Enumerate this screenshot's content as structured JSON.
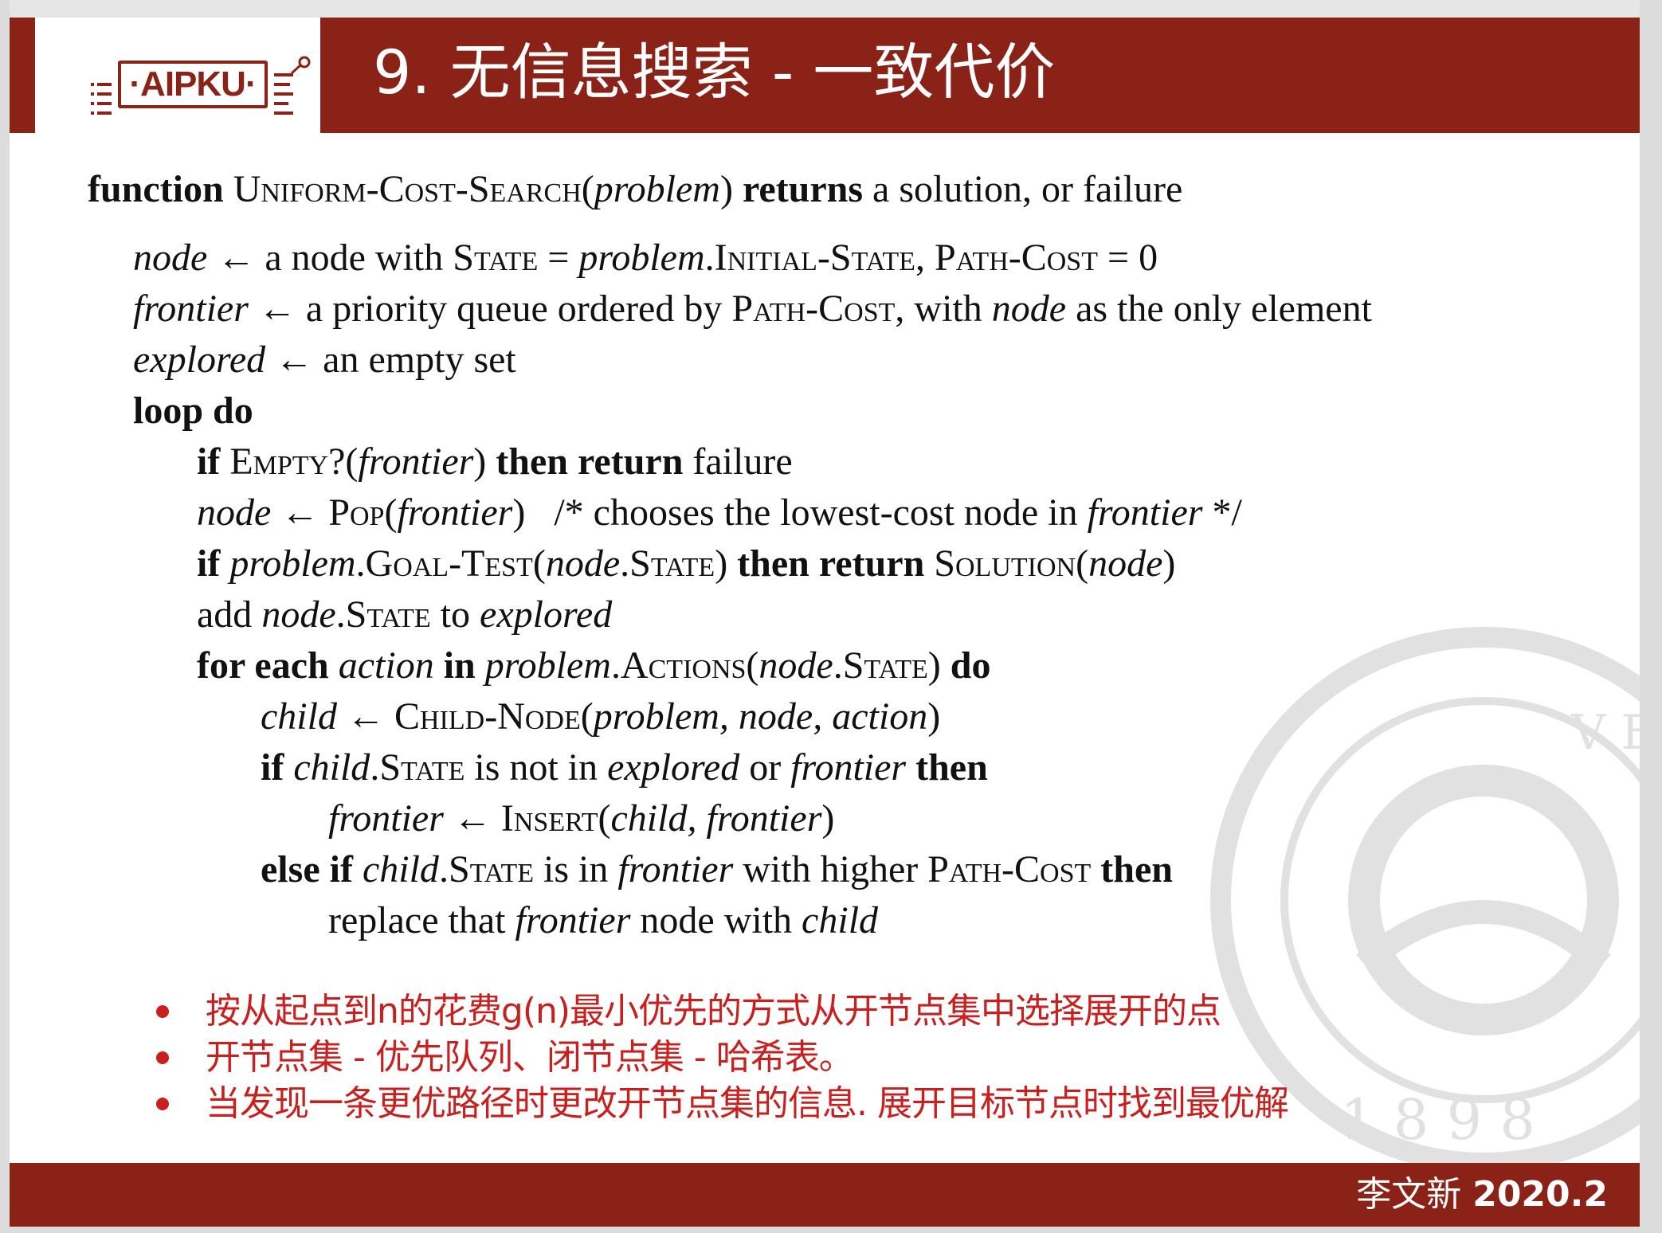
{
  "header": {
    "logo_text": "·AIPKU·",
    "title": "9. 无信息搜索 - 一致代价"
  },
  "pseudocode": {
    "line1": {
      "kw1": "function",
      "name": "Uniform-Cost-Search",
      "arg": "problem",
      "kw2": "returns",
      "rest": "a solution, or failure"
    },
    "line2": {
      "v1": "node",
      "t1": "← a node with",
      "s1": "State",
      "t2": "=",
      "v2": "problem",
      "s2": ".Initial-State,",
      "s3": "Path-Cost",
      "t3": "= 0"
    },
    "line3": {
      "v1": "frontier",
      "t1": "← a priority queue ordered by",
      "s1": "Path-Cost",
      "t2": ", with",
      "v2": "node",
      "t3": "as the only element"
    },
    "line4": {
      "v1": "explored",
      "t1": "← an empty set"
    },
    "line5": {
      "kw": "loop do"
    },
    "line6": {
      "kw1": "if",
      "s1": "Empty?",
      "t1": "(",
      "v1": "frontier",
      "t2": ")",
      "kw2": "then return",
      "t3": "failure"
    },
    "line7": {
      "v1": "node",
      "t1": "←",
      "s1": "Pop",
      "t2": "(",
      "v2": "frontier",
      "t3": ")",
      "c1": "/* chooses the lowest-cost node in",
      "v3": "frontier",
      "c2": "*/"
    },
    "line8": {
      "kw1": "if",
      "v1": "problem",
      "s1": ".Goal-Test",
      "t1": "(",
      "v2": "node",
      "s2": ".State",
      "t2": ")",
      "kw2": "then return",
      "s3": "Solution",
      "t3": "(",
      "v3": "node",
      "t4": ")"
    },
    "line9": {
      "t1": "add",
      "v1": "node",
      "s1": ".State",
      "t2": "to",
      "v2": "explored"
    },
    "line10": {
      "kw1": "for each",
      "v1": "action",
      "kw2": "in",
      "v2": "problem",
      "s1": ".Actions",
      "t1": "(",
      "v3": "node",
      "s2": ".State",
      "t2": ")",
      "kw3": "do"
    },
    "line11": {
      "v1": "child",
      "t1": "←",
      "s1": "Child-Node",
      "t2": "(",
      "v2": "problem, node, action",
      "t3": ")"
    },
    "line12": {
      "kw1": "if",
      "v1": "child",
      "s1": ".State",
      "t1": "is not in",
      "v2": "explored",
      "t2": "or",
      "v3": "frontier",
      "kw2": "then"
    },
    "line13": {
      "v1": "frontier",
      "t1": "←",
      "s1": "Insert",
      "t2": "(",
      "v2": "child, frontier",
      "t3": ")"
    },
    "line14": {
      "kw1": "else if",
      "v1": "child",
      "s1": ".State",
      "t1": "is in",
      "v2": "frontier",
      "t2": "with higher",
      "s2": "Path-Cost",
      "kw2": "then"
    },
    "line15": {
      "t1": "replace that",
      "v1": "frontier",
      "t2": "node with",
      "v2": "child"
    }
  },
  "bullets": [
    "按从起点到n的花费g(n)最小优先的方式从开节点集中选择展开的点",
    "开节点集 - 优先队列、闭节点集 - 哈希表。",
    "当发现一条更优路径时更改开节点集的信息. 展开目标节点时找到最优解"
  ],
  "footer": {
    "author": "李文新",
    "year": "2020.2"
  },
  "watermark": {
    "letters": "1 8 9 8",
    "side_letters": "V E"
  },
  "colors": {
    "brand_red": "#8b2218",
    "bullet_red": "#c8201f"
  }
}
